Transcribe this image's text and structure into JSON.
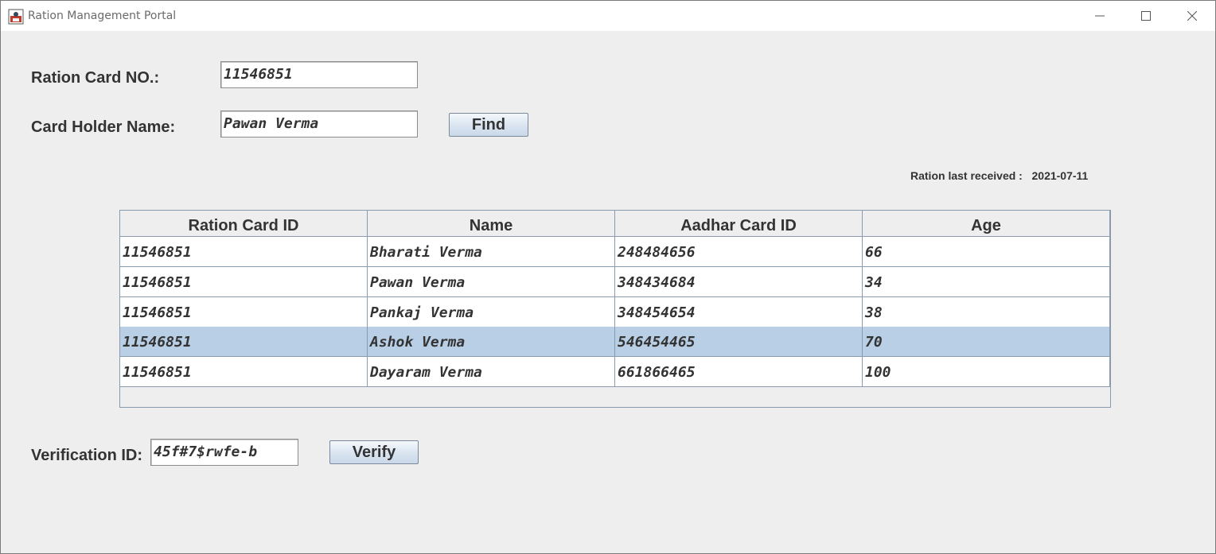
{
  "window": {
    "title": "Ration Management Portal",
    "controls": {
      "minimize": "minimize-icon",
      "maximize": "maximize-icon",
      "close": "close-icon"
    }
  },
  "form": {
    "ration_card_label": "Ration Card NO.:",
    "ration_card_value": "11546851",
    "holder_name_label": "Card Holder Name:",
    "holder_name_value": "Pawan Verma",
    "find_button": "Find"
  },
  "status": {
    "last_received_label": "Ration last received :",
    "last_received_date": "2021-07-11"
  },
  "table": {
    "columns": [
      "Ration Card ID",
      "Name",
      "Aadhar Card ID",
      "Age"
    ],
    "rows": [
      [
        "11546851",
        "Bharati Verma",
        "248484656",
        "66"
      ],
      [
        "11546851",
        "Pawan Verma",
        "348434684",
        "34"
      ],
      [
        "11546851",
        "Pankaj Verma",
        "348454654",
        "38"
      ],
      [
        "11546851",
        "Ashok Verma",
        "546454465",
        "70"
      ],
      [
        "11546851",
        "Dayaram Verma",
        "661866465",
        "100"
      ]
    ],
    "selected_row": 3
  },
  "verification": {
    "label": "Verification ID:",
    "value": "45f#7$rwfe-b",
    "verify_button": "Verify"
  },
  "colors": {
    "window_bg": "#eeeeee",
    "selected_row": "#b8cfe5",
    "grid_line": "#8a9bb0"
  }
}
